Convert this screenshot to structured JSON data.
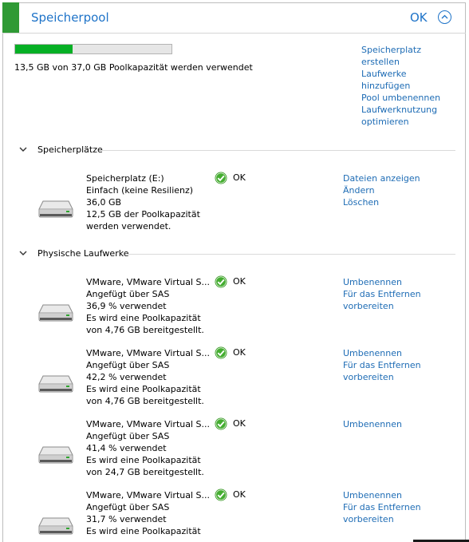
{
  "header": {
    "title": "Speicherpool",
    "status": "OK"
  },
  "pool": {
    "used_fraction": 0.365,
    "capacity_text": "13,5 GB von 37,0 GB Poolkapazität werden verwendet"
  },
  "pool_actions": [
    "Speicherplatz",
    "erstellen",
    "Laufwerke",
    "hinzufügen",
    "Pool umbenennen",
    "Laufwerknutzung",
    "optimieren"
  ],
  "spaces_section": {
    "label": "Speicherplätze"
  },
  "spaces": [
    {
      "lines": [
        "Speicherplatz (E:)",
        "Einfach (keine Resilienz)",
        "36,0 GB",
        "12,5 GB der Poolkapazität",
        "werden verwendet."
      ],
      "status": "OK",
      "actions": [
        "Dateien anzeigen",
        "Ändern",
        "Löschen"
      ]
    }
  ],
  "drives_section": {
    "label": "Physische Laufwerke"
  },
  "drives": [
    {
      "lines": [
        "VMware, VMware Virtual S...",
        "Angefügt über SAS",
        "36,9 % verwendet",
        "Es wird eine Poolkapazität",
        "von 4,76 GB bereitgestellt."
      ],
      "status": "OK",
      "actions": [
        "Umbenennen",
        "Für das Entfernen",
        "vorbereiten"
      ]
    },
    {
      "lines": [
        "VMware, VMware Virtual S...",
        "Angefügt über SAS",
        "42,2 % verwendet",
        "Es wird eine Poolkapazität",
        "von 4,76 GB bereitgestellt."
      ],
      "status": "OK",
      "actions": [
        "Umbenennen",
        "Für das Entfernen",
        "vorbereiten"
      ]
    },
    {
      "lines": [
        "VMware, VMware Virtual S...",
        "Angefügt über SAS",
        "41,4 % verwendet",
        "Es wird eine Poolkapazität",
        "von 24,7 GB bereitgestellt."
      ],
      "status": "OK",
      "actions": [
        "Umbenennen"
      ]
    },
    {
      "lines": [
        "VMware, VMware Virtual S...",
        "Angefügt über SAS",
        "31,7 % verwendet",
        "Es wird eine Poolkapazität"
      ],
      "status": "OK",
      "actions": [
        "Umbenennen",
        "Für das Entfernen",
        "vorbereiten"
      ]
    }
  ],
  "colors": {
    "accent": "#1e73c8",
    "link": "#1e6cb5",
    "header_bar": "#2f9a35",
    "progress_fill": "#06b025",
    "ok_green": "#3a9a28"
  }
}
